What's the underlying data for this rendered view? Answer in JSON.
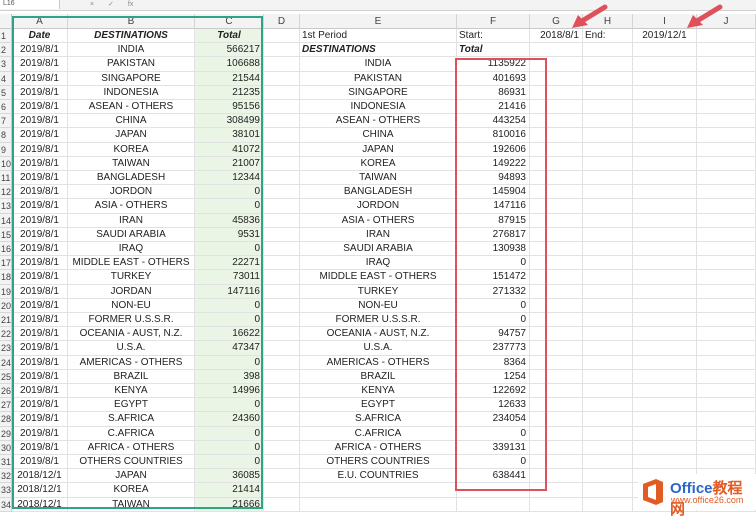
{
  "window": {
    "name_box": "L16",
    "fx_symbols": [
      "×",
      "✓",
      "fx"
    ]
  },
  "columns": [
    "",
    "A",
    "B",
    "C",
    "D",
    "E",
    "F",
    "G",
    "H",
    "I",
    "J"
  ],
  "rows": [
    [
      "1",
      "Date",
      "DESTINATIONS",
      "Total",
      "",
      "1st Period",
      "Start:",
      "2018/8/1",
      "End:",
      "2019/12/1",
      ""
    ],
    [
      "2",
      "2019/8/1",
      "INDIA",
      "566217",
      "",
      "DESTINATIONS",
      "Total",
      "",
      "",
      "",
      ""
    ],
    [
      "3",
      "2019/8/1",
      "PAKISTAN",
      "106688",
      "",
      "INDIA",
      "1135922",
      "",
      "",
      "",
      ""
    ],
    [
      "4",
      "2019/8/1",
      "SINGAPORE",
      "21544",
      "",
      "PAKISTAN",
      "401693",
      "",
      "",
      "",
      ""
    ],
    [
      "5",
      "2019/8/1",
      "INDONESIA",
      "21235",
      "",
      "SINGAPORE",
      "86931",
      "",
      "",
      "",
      ""
    ],
    [
      "6",
      "2019/8/1",
      "ASEAN - OTHERS",
      "95156",
      "",
      "INDONESIA",
      "21416",
      "",
      "",
      "",
      ""
    ],
    [
      "7",
      "2019/8/1",
      "CHINA",
      "308499",
      "",
      "ASEAN - OTHERS",
      "443254",
      "",
      "",
      "",
      ""
    ],
    [
      "8",
      "2019/8/1",
      "JAPAN",
      "38101",
      "",
      "CHINA",
      "810016",
      "",
      "",
      "",
      ""
    ],
    [
      "9",
      "2019/8/1",
      "KOREA",
      "41072",
      "",
      "JAPAN",
      "192606",
      "",
      "",
      "",
      ""
    ],
    [
      "10",
      "2019/8/1",
      "TAIWAN",
      "21007",
      "",
      "KOREA",
      "149222",
      "",
      "",
      "",
      ""
    ],
    [
      "11",
      "2019/8/1",
      "BANGLADESH",
      "12344",
      "",
      "TAIWAN",
      "94893",
      "",
      "",
      "",
      ""
    ],
    [
      "12",
      "2019/8/1",
      "JORDON",
      "0",
      "",
      "BANGLADESH",
      "145904",
      "",
      "",
      "",
      ""
    ],
    [
      "13",
      "2019/8/1",
      "ASIA - OTHERS",
      "0",
      "",
      "JORDON",
      "147116",
      "",
      "",
      "",
      ""
    ],
    [
      "14",
      "2019/8/1",
      "IRAN",
      "45836",
      "",
      "ASIA - OTHERS",
      "87915",
      "",
      "",
      "",
      ""
    ],
    [
      "15",
      "2019/8/1",
      "SAUDI ARABIA",
      "9531",
      "",
      "IRAN",
      "276817",
      "",
      "",
      "",
      ""
    ],
    [
      "16",
      "2019/8/1",
      "IRAQ",
      "0",
      "",
      "SAUDI ARABIA",
      "130938",
      "",
      "",
      "",
      ""
    ],
    [
      "17",
      "2019/8/1",
      "MIDDLE EAST - OTHERS",
      "22271",
      "",
      "IRAQ",
      "0",
      "",
      "",
      "",
      ""
    ],
    [
      "18",
      "2019/8/1",
      "TURKEY",
      "73011",
      "",
      "MIDDLE EAST - OTHERS",
      "151472",
      "",
      "",
      "",
      ""
    ],
    [
      "19",
      "2019/8/1",
      "JORDAN",
      "147116",
      "",
      "TURKEY",
      "271332",
      "",
      "",
      "",
      ""
    ],
    [
      "20",
      "2019/8/1",
      "NON-EU",
      "0",
      "",
      "NON-EU",
      "0",
      "",
      "",
      "",
      ""
    ],
    [
      "21",
      "2019/8/1",
      "FORMER U.S.S.R.",
      "0",
      "",
      "FORMER U.S.S.R.",
      "0",
      "",
      "",
      "",
      ""
    ],
    [
      "22",
      "2019/8/1",
      "OCEANIA - AUST, N.Z.",
      "16622",
      "",
      "OCEANIA - AUST, N.Z.",
      "94757",
      "",
      "",
      "",
      ""
    ],
    [
      "23",
      "2019/8/1",
      "U.S.A.",
      "47347",
      "",
      "U.S.A.",
      "237773",
      "",
      "",
      "",
      ""
    ],
    [
      "24",
      "2019/8/1",
      "AMERICAS - OTHERS",
      "0",
      "",
      "AMERICAS - OTHERS",
      "8364",
      "",
      "",
      "",
      ""
    ],
    [
      "25",
      "2019/8/1",
      "BRAZIL",
      "398",
      "",
      "BRAZIL",
      "1254",
      "",
      "",
      "",
      ""
    ],
    [
      "26",
      "2019/8/1",
      "KENYA",
      "14996",
      "",
      "KENYA",
      "122692",
      "",
      "",
      "",
      ""
    ],
    [
      "27",
      "2019/8/1",
      "EGYPT",
      "0",
      "",
      "EGYPT",
      "12633",
      "",
      "",
      "",
      ""
    ],
    [
      "28",
      "2019/8/1",
      "S.AFRICA",
      "24360",
      "",
      "S.AFRICA",
      "234054",
      "",
      "",
      "",
      ""
    ],
    [
      "29",
      "2019/8/1",
      "C.AFRICA",
      "0",
      "",
      "C.AFRICA",
      "0",
      "",
      "",
      "",
      ""
    ],
    [
      "30",
      "2019/8/1",
      "AFRICA - OTHERS",
      "0",
      "",
      "AFRICA - OTHERS",
      "339131",
      "",
      "",
      "",
      ""
    ],
    [
      "31",
      "2019/8/1",
      "OTHERS COUNTRIES",
      "0",
      "",
      "OTHERS COUNTRIES",
      "0",
      "",
      "",
      "",
      ""
    ],
    [
      "32",
      "2018/12/1",
      "JAPAN",
      "36085",
      "",
      "E.U. COUNTRIES",
      "638441",
      "",
      "",
      "",
      ""
    ],
    [
      "33",
      "2018/12/1",
      "KOREA",
      "21414",
      "",
      "",
      "",
      "",
      "",
      "",
      ""
    ],
    [
      "34",
      "2018/12/1",
      "TAIWAN",
      "21666",
      "",
      "",
      "",
      "",
      "",
      "",
      ""
    ]
  ],
  "colors": {
    "green_box": "#2ea386",
    "red_box": "#e0505a",
    "col_c_fill": "#eaf5e6"
  },
  "icons": [
    "red-arrow-icon",
    "office-logo-icon"
  ],
  "watermark": {
    "title": "Office",
    "title_cn": "教程网",
    "url": "www.office26.com"
  }
}
